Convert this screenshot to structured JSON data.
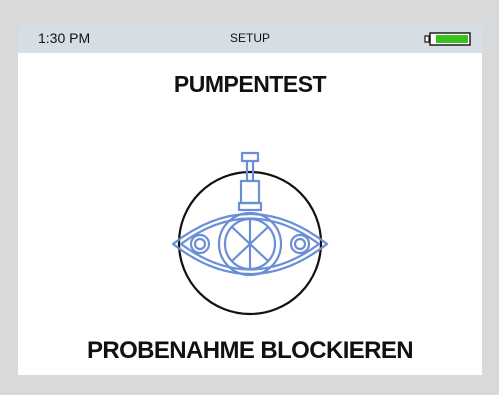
{
  "status_bar": {
    "time": "1:30 PM",
    "mode": "SETUP",
    "battery_icon": "battery-full-icon",
    "battery_color": "#3cc21f"
  },
  "screen": {
    "title": "PUMPENTEST",
    "illustration_icon": "pump-icon",
    "illustration_color": "#6b8fd6",
    "action_label": "PROBENAHME BLOCKIEREN"
  },
  "colors": {
    "background": "#d7d9db",
    "status_bar": "#d7dee3",
    "screen": "#ffffff",
    "text": "#111111"
  }
}
